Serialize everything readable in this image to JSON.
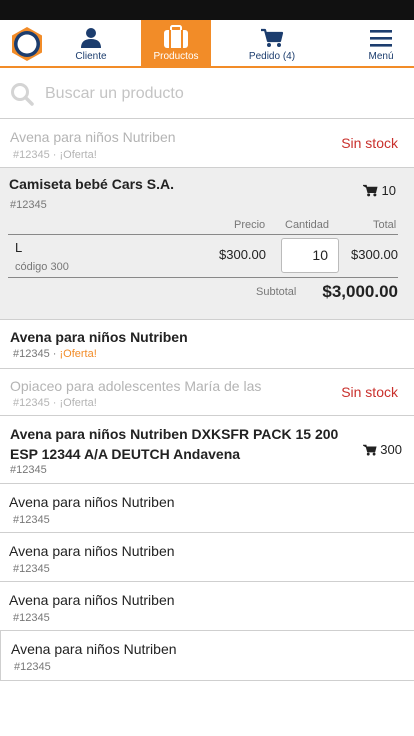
{
  "nav": {
    "cliente": "Cliente",
    "productos": "Productos",
    "pedido": "Pedido (4)",
    "menu": "Menú",
    "accent": "#f28c28",
    "brand": "#1c3d6e"
  },
  "search": {
    "placeholder": "Buscar un producto",
    "value": ""
  },
  "products": {
    "p1": {
      "name": "Avena para niños Nutriben",
      "sub": "#12345 · ¡Oferta!",
      "status": "Sin stock"
    },
    "p2": {
      "name": "Camiseta bebé Cars S.A.",
      "sub": "#12345",
      "cart_qty": "10",
      "headers": {
        "precio": "Precio",
        "cantidad": "Cantidad",
        "total": "Total"
      },
      "line": {
        "size": "L",
        "code": "código 300",
        "price": "$300.00",
        "quantity": "10",
        "total": "$300.00"
      },
      "subtotal_label": "Subtotal",
      "subtotal_value": "$3,000.00"
    },
    "p3": {
      "name": "Avena para niños Nutriben",
      "code": "#12345",
      "sep": " · ",
      "offer": "¡Oferta!"
    },
    "p4": {
      "name": "Opiaceo para adolescentes María de las",
      "sub": "#12345 · ¡Oferta!",
      "status": "Sin stock"
    },
    "p5": {
      "name_line1": "Avena para niños Nutriben DXKSFR PACK 15 200",
      "name_line2": "ESP 12344 A/A DEUTCH Andavena",
      "sub": "#12345",
      "cart_qty": "300"
    },
    "p6": {
      "name": "Avena para niños Nutriben",
      "sub": "#12345"
    },
    "p7": {
      "name": "Avena para niños Nutriben",
      "sub": "#12345"
    },
    "p8": {
      "name": "Avena para niños Nutriben",
      "sub": "#12345"
    },
    "p9": {
      "name": "Avena para niños Nutriben",
      "sub": "#12345"
    }
  },
  "icons": {
    "logo": "logo-ring",
    "cliente": "user-icon",
    "productos": "briefcase-icon",
    "pedido": "cart-icon",
    "menu": "hamburger-icon",
    "search": "search-icon"
  },
  "colors": {
    "out_of_stock": "#c9302c",
    "offer": "#f28c28"
  }
}
